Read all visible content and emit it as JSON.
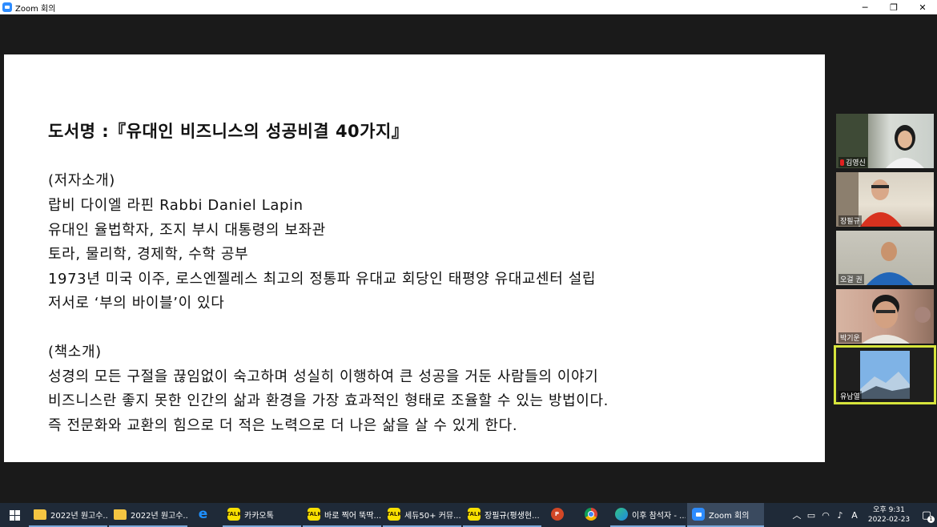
{
  "window": {
    "title": "Zoom 회의",
    "minimize": "─",
    "restore": "❐",
    "close": "✕"
  },
  "slide": {
    "title": "도서명 :『유대인 비즈니스의 성공비결 40가지』",
    "lines": [
      "(저자소개)",
      "랍비 다이엘 라핀   Rabbi Daniel Lapin",
      "유대인 율법학자, 조지 부시 대통령의 보좌관",
      "토라, 물리학, 경제학, 수학 공부",
      "1973년 미국 이주, 로스엔젤레스 최고의 정통파 유대교 회당인 태평양 유대교센터 설립",
      "저서로 ‘부의 바이블’이 있다",
      "(책소개)",
      "성경의 모든 구절을 끊임없이 숙고하며 성실히 이행하여 큰 성공을 거둔 사람들의 이야기",
      "비즈니스란 좋지 못한 인간의 삶과 환경을 가장 효과적인 형태로 조율할 수 있는 방법이다.",
      "즉 전문화와 교환의 힘으로 더 적은 노력으로 더 나은 삶을 살 수 있게 한다."
    ]
  },
  "participants": [
    {
      "name": "김영신",
      "muted": true
    },
    {
      "name": "장필규",
      "muted": false
    },
    {
      "name": "오걸 권",
      "muted": false
    },
    {
      "name": "박기운",
      "muted": false
    },
    {
      "name": "유남열",
      "muted": false,
      "active": true
    }
  ],
  "taskbar": {
    "items": [
      {
        "label": "2022년 원고수...",
        "icon": "folder-icon"
      },
      {
        "label": "2022년 원고수...",
        "icon": "folder-icon"
      },
      {
        "label": "",
        "icon": "ie-icon"
      },
      {
        "label": "카카오톡",
        "icon": "kakaotalk-icon"
      },
      {
        "label": "바로 찍어 뚝딱...",
        "icon": "kakaotalk-icon"
      },
      {
        "label": "세듀50+ 커뮤...",
        "icon": "kakaotalk-icon"
      },
      {
        "label": "장필규(평생현...",
        "icon": "kakaotalk-icon"
      },
      {
        "label": "",
        "icon": "powerpoint-icon"
      },
      {
        "label": "",
        "icon": "chrome-icon"
      },
      {
        "label": "이후 참석자 - ...",
        "icon": "edge-icon"
      },
      {
        "label": "Zoom 회의",
        "icon": "zoom-icon"
      }
    ],
    "talk_badge": "TALK",
    "ime": "A",
    "time": "오후 9:31",
    "date": "2022-02-23",
    "notification_count": "1"
  }
}
